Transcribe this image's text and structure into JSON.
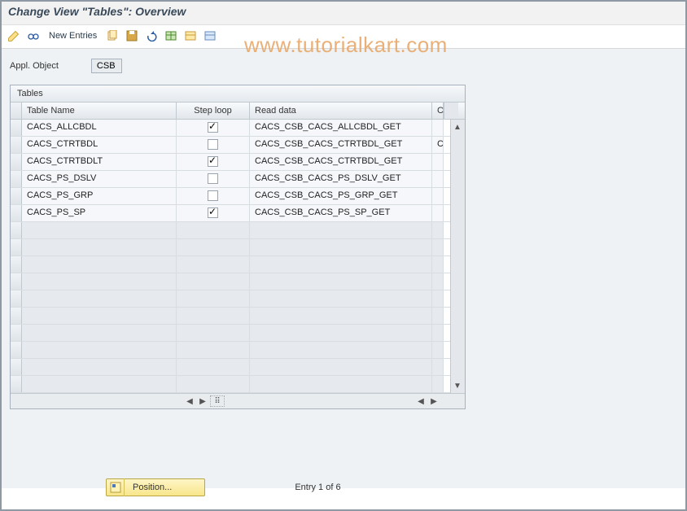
{
  "title": "Change View \"Tables\": Overview",
  "watermark": "www.tutorialkart.com",
  "toolbar": {
    "new_entries": "New Entries"
  },
  "appl": {
    "label": "Appl. Object",
    "value": "CSB"
  },
  "panel": {
    "title": "Tables",
    "columns": {
      "name": "Table Name",
      "step": "Step loop",
      "read": "Read data",
      "c": "C"
    },
    "rows": [
      {
        "name": "CACS_ALLCBDL",
        "step": true,
        "read": "CACS_CSB_CACS_ALLCBDL_GET",
        "c": ""
      },
      {
        "name": "CACS_CTRTBDL",
        "step": false,
        "read": "CACS_CSB_CACS_CTRTBDL_GET",
        "c": "C"
      },
      {
        "name": "CACS_CTRTBDLT",
        "step": true,
        "read": "CACS_CSB_CACS_CTRTBDL_GET",
        "c": ""
      },
      {
        "name": "CACS_PS_DSLV",
        "step": false,
        "read": "CACS_CSB_CACS_PS_DSLV_GET",
        "c": ""
      },
      {
        "name": "CACS_PS_GRP",
        "step": false,
        "read": "CACS_CSB_CACS_PS_GRP_GET",
        "c": ""
      },
      {
        "name": "CACS_PS_SP",
        "step": true,
        "read": "CACS_CSB_CACS_PS_SP_GET",
        "c": ""
      }
    ],
    "blank_rows": 10
  },
  "footer": {
    "position_btn": "Position...",
    "entry_label": "Entry 1 of 6"
  }
}
